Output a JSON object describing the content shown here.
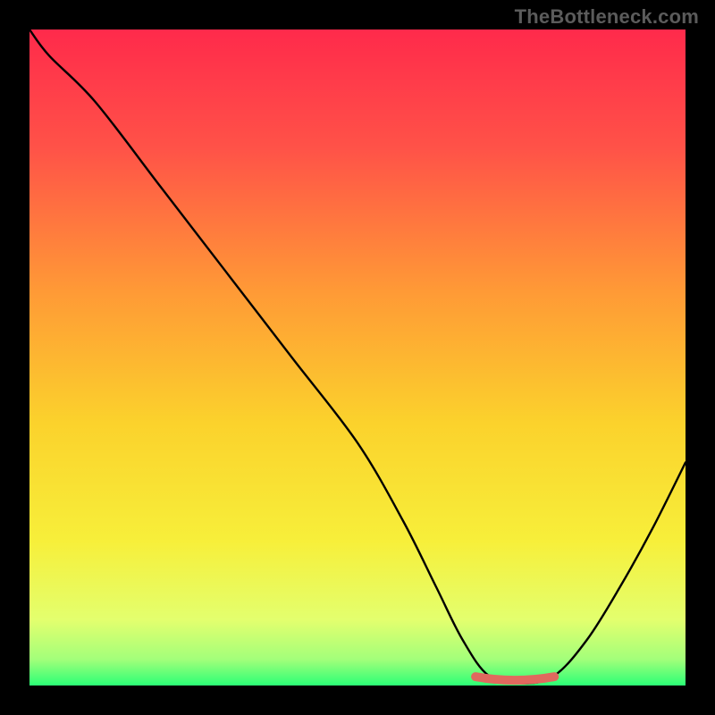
{
  "watermark": "TheBottleneck.com",
  "chart_data": {
    "type": "line",
    "title": "",
    "xlabel": "",
    "ylabel": "",
    "xlim": [
      0,
      100
    ],
    "ylim": [
      0,
      100
    ],
    "grid": false,
    "series": [
      {
        "name": "curve",
        "color": "#000000",
        "x": [
          0,
          3,
          10,
          20,
          30,
          40,
          50,
          57,
          62,
          66,
          70,
          75,
          80,
          85,
          90,
          95,
          100
        ],
        "y": [
          100,
          96,
          89,
          76,
          63,
          50,
          37,
          25,
          15,
          7,
          1.5,
          0.3,
          1.5,
          7,
          15,
          24,
          34
        ]
      },
      {
        "name": "highlight-band",
        "color": "#e0695e",
        "x": [
          68,
          80
        ],
        "y": [
          0.8,
          0.8
        ]
      }
    ],
    "gradient_stops": [
      {
        "offset": 0,
        "color": "#ff2a4b"
      },
      {
        "offset": 18,
        "color": "#ff5248"
      },
      {
        "offset": 40,
        "color": "#ff9a36"
      },
      {
        "offset": 60,
        "color": "#fbd22c"
      },
      {
        "offset": 78,
        "color": "#f7ef3a"
      },
      {
        "offset": 90,
        "color": "#e3ff6e"
      },
      {
        "offset": 96,
        "color": "#a3ff7a"
      },
      {
        "offset": 100,
        "color": "#2bff76"
      }
    ]
  }
}
